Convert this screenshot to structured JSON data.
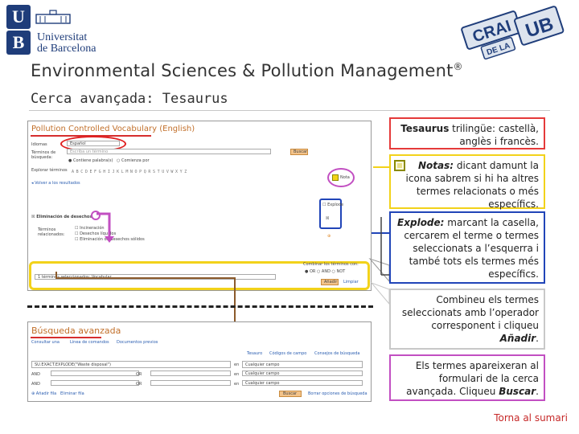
{
  "header": {
    "logo_letters": [
      "U",
      "B"
    ],
    "logo_name_line1": "Universitat",
    "logo_name_line2": "de Barcelona",
    "crai_text": "CRAI",
    "crai_sub": "DE LA",
    "crai_ub": "UB",
    "title": "Environmental Sciences & Pollution Management",
    "title_mark": "®",
    "subtitle": "Cerca avançada: Tesaurus"
  },
  "shot1": {
    "title": "Pollution Controlled Vocabulary",
    "title_lang": "(English)",
    "idioma_label": "Idiomas",
    "idioma_value": "Español",
    "term_label": "Términos de búsqueda:",
    "term_placeholder": "Escriba un término",
    "search_btn": "Buscar",
    "opt1": "Contiene palabra(s)",
    "opt2": "Comienza por",
    "explore_label": "Explorar términos",
    "alphabet": "ABCDEFGHIJKLMNOPQRSTUVWXYZ",
    "back_link": "Volver a los resultados",
    "note_label": "Nota",
    "explode_label": "Explode",
    "entry_term": "Eliminación de desechos",
    "related_label": "Términos relacionados:",
    "related": [
      "Incineración",
      "Desechos líquidos",
      "Eliminación de desechos sólidos"
    ],
    "combine_label": "Combinar los términos con:",
    "combine_ops": [
      "OR",
      "AND",
      "NOT"
    ],
    "selected_text": "1 términos seleccionados: Vocabular",
    "add_btn": "Añadir",
    "clear_link": "Limpiar"
  },
  "shot2": {
    "title": "Búsqueda avanzada",
    "tabs": [
      "Consultar una",
      "Línea de comandos",
      "Documentos previos"
    ],
    "tools": [
      "Tesauro",
      "Códigos de campo",
      "Consejos de búsqueda"
    ],
    "query": "SU.EXACT.EXPLODE(\"Waste disposal\")",
    "field_in": "en",
    "field_value": "Cualquier campo",
    "op_and": "AND",
    "op_or": "OR",
    "add_row": "Añadir fila",
    "remove_row": "Eliminar fila",
    "search_btn": "Buscar",
    "clear_form": "Borrar opciones de búsqueda"
  },
  "boxes": {
    "b1_bold": "Tesaurus",
    "b1_rest": " trilingüe: castellà, anglès i francès.",
    "b2_bold": "Notas:",
    "b2_rest": " dicant damunt la icona sabrem si hi ha altres termes relacionats o més específics.",
    "b3_bold": "Explode:",
    "b3_rest": " marcant la casella, cercarem el terme o termes seleccionats a l’esquerra i també tots els termes més específics.",
    "b4_rest": "Combineu els termes seleccionats amb l’operador corresponent i cliqueu ",
    "b4_bold": "Añadir",
    "b4_end": ".",
    "b5_rest": "Els termes apareixeran al formulari de la cerca avançada. Cliqueu ",
    "b5_bold": "Buscar",
    "b5_end": "."
  },
  "footer": {
    "torna": "Torna al sumari"
  },
  "colors": {
    "red_box": "#e53a3a",
    "yellow_box": "#f2d21a",
    "blue_box": "#2145b8",
    "magenta_box": "#c24fc2",
    "brand_orange": "#c2702b",
    "ub_blue": "#1f3d7a"
  }
}
